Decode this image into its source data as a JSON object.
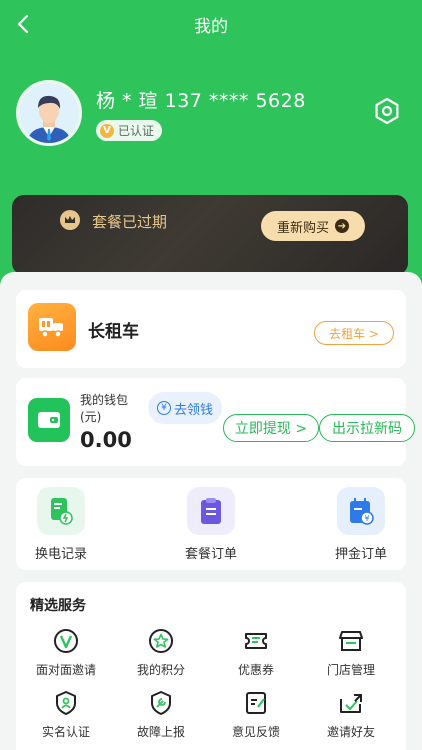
{
  "header": {
    "title": "我的"
  },
  "profile": {
    "name_phone": "杨 * 瑄 137 **** 5628",
    "verified_label": "已认证",
    "verified_mark": "V"
  },
  "package": {
    "status": "套餐已过期",
    "rebuy_label": "重新购买",
    "rebuy_arrow": "➔"
  },
  "long_rent": {
    "title": "长租车",
    "button": "去租车 >"
  },
  "wallet": {
    "label": "我的钱包(元)",
    "amount": "0.00",
    "claim_label": "去领钱",
    "claim_coin": "¥",
    "withdraw_label": "立即提现 >",
    "invite_code_label": "出示拉新码"
  },
  "orders": [
    {
      "label": "换电记录"
    },
    {
      "label": "套餐订单"
    },
    {
      "label": "押金订单"
    }
  ],
  "services": {
    "title": "精选服务",
    "items": [
      {
        "label": "面对面邀请",
        "icon": "v-badge-icon"
      },
      {
        "label": "我的积分",
        "icon": "star-icon"
      },
      {
        "label": "优惠券",
        "icon": "coupon-icon"
      },
      {
        "label": "门店管理",
        "icon": "store-icon"
      },
      {
        "label": "实名认证",
        "icon": "id-shield-icon"
      },
      {
        "label": "故障上报",
        "icon": "wrench-shield-icon"
      },
      {
        "label": "意见反馈",
        "icon": "feedback-icon"
      },
      {
        "label": "邀请好友",
        "icon": "invite-icon"
      }
    ]
  },
  "colors": {
    "primary": "#2ec45b",
    "gold": "#e7c68d",
    "orange": "#f0a23b",
    "blue": "#2c7be5"
  }
}
